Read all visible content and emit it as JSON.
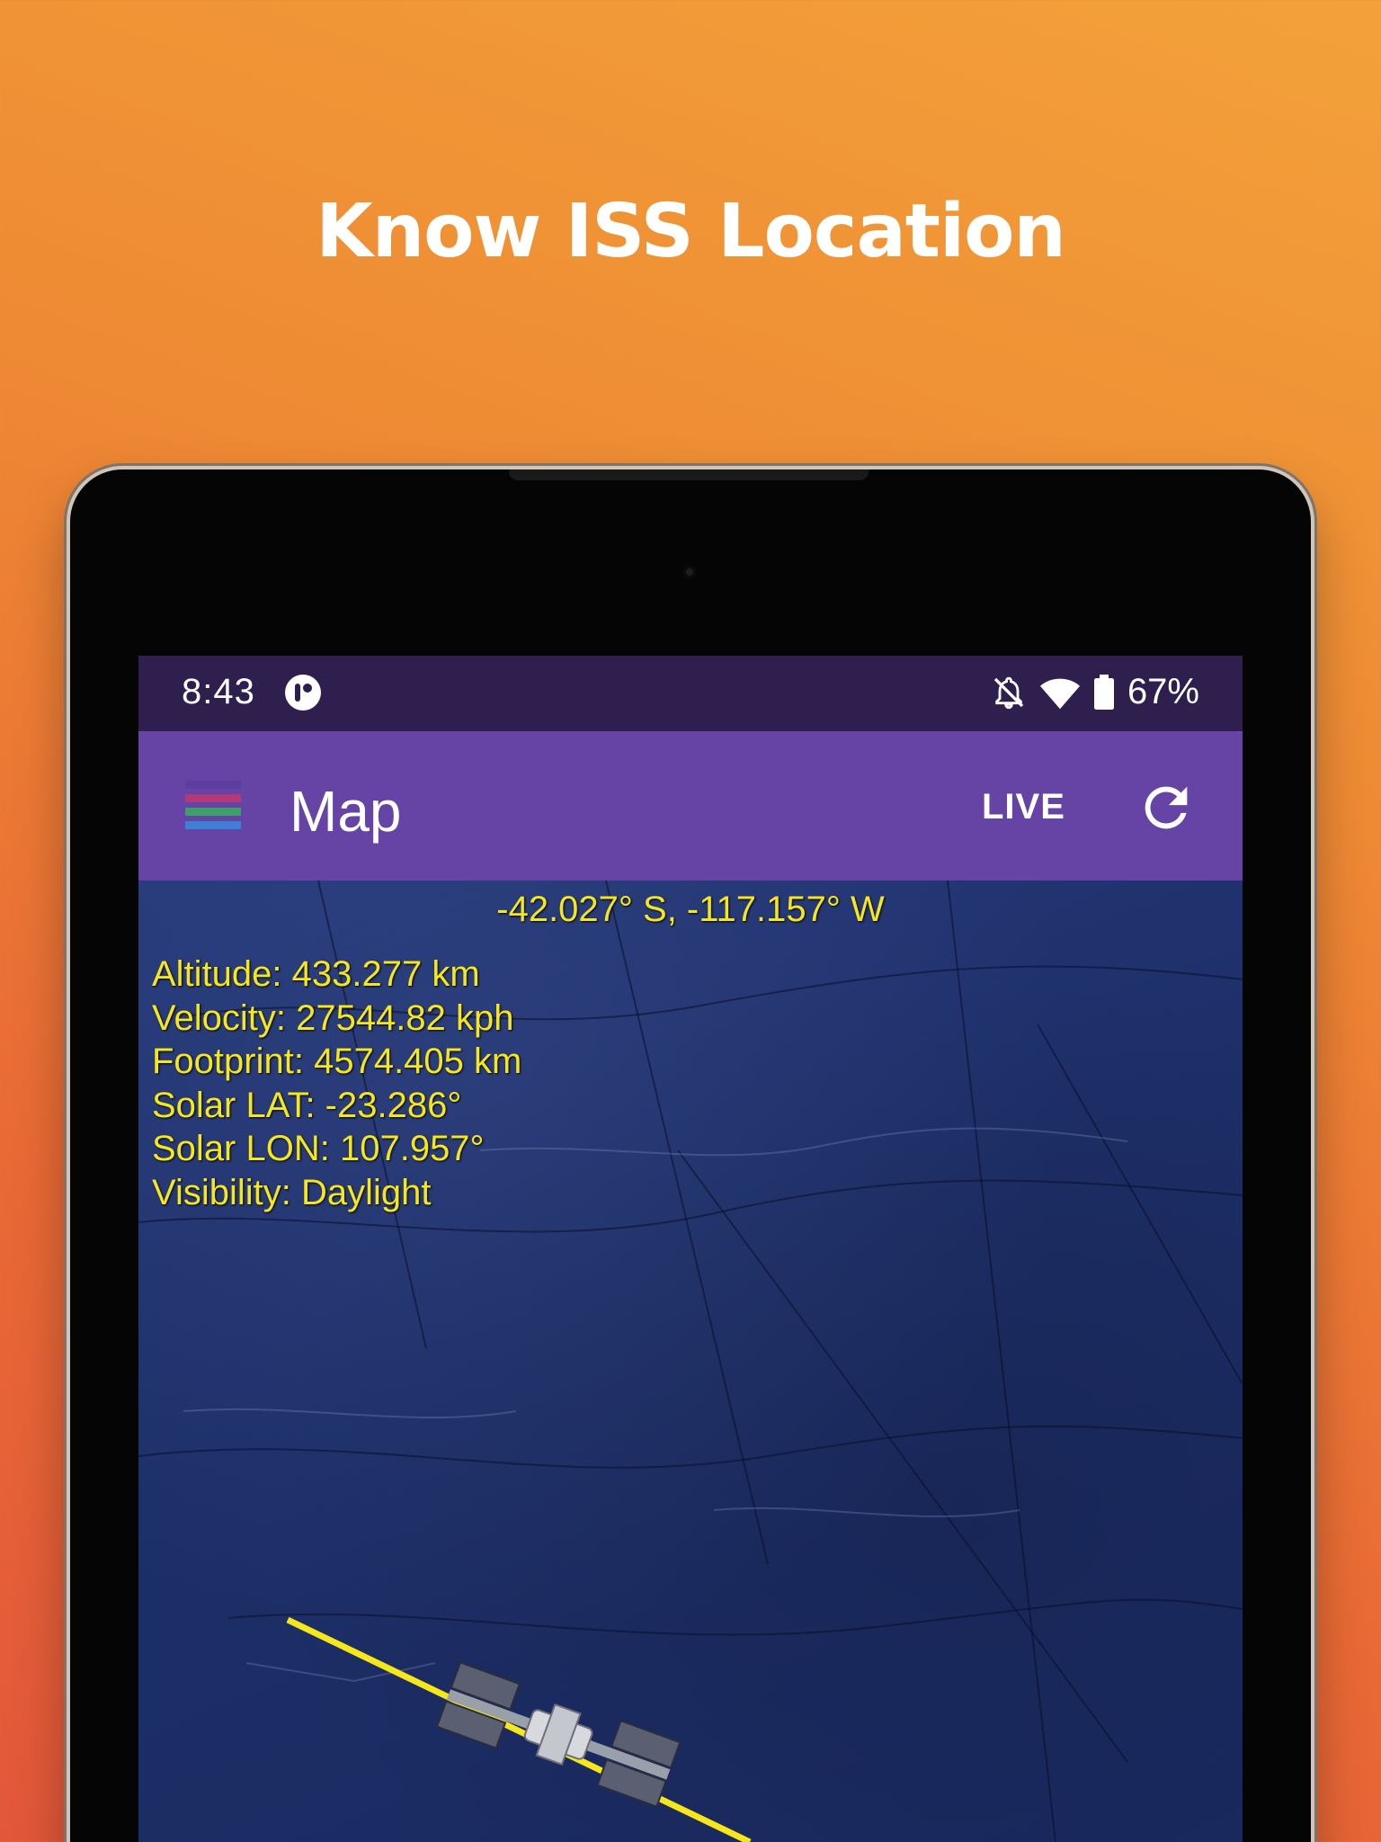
{
  "headline": "Know ISS Location",
  "status_bar": {
    "time": "8:43",
    "battery": "67%"
  },
  "app_bar": {
    "title": "Map",
    "live_label": "LIVE"
  },
  "map": {
    "coordinates": "-42.027° S, -117.157° W",
    "stats": [
      "Altitude: 433.277 km",
      "Velocity: 27544.82 kph",
      "Footprint: 4574.405 km",
      "Solar LAT: -23.286°",
      "Solar LON: 107.957°",
      "Visibility: Daylight"
    ]
  },
  "icons": {
    "menu": "menu-icon",
    "refresh": "refresh-icon",
    "notifications_off": "notifications-off-icon",
    "wifi": "wifi-icon",
    "battery": "battery-icon",
    "app": "app-icon",
    "iss": "iss-icon"
  },
  "colors": {
    "background_top": "#f3a13a",
    "background_bottom": "#e2573a",
    "status_bar": "#2f1f4f",
    "app_bar": "#6644a6",
    "text_highlight": "#f5e71a",
    "ocean": "#1f3266",
    "menu_stripes": [
      "#5b3fa0",
      "#b33a7a",
      "#3f9f6a",
      "#3f7fd6"
    ]
  }
}
